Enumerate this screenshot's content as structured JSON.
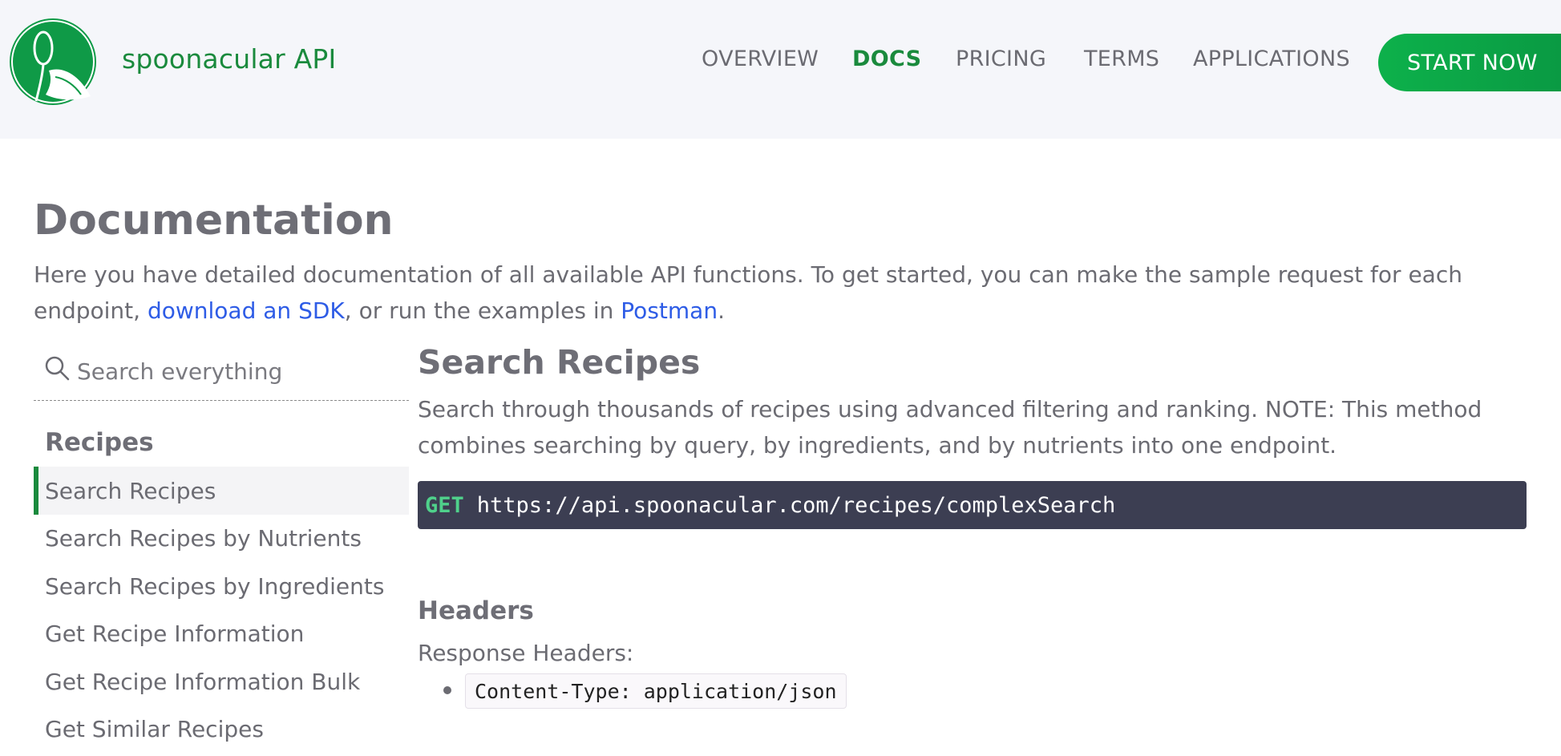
{
  "header": {
    "brand": "spoonacular API",
    "nav": [
      {
        "label": "OVERVIEW",
        "active": false
      },
      {
        "label": "DOCS",
        "active": true
      },
      {
        "label": "PRICING",
        "active": false
      },
      {
        "label": "TERMS",
        "active": false
      },
      {
        "label": "APPLICATIONS",
        "active": false
      }
    ],
    "cta_label": "START NOW",
    "logo_icon": "spoon-leaf-logo"
  },
  "intro": {
    "title": "Documentation",
    "text_before": "Here you have detailed documentation of all available API functions. To get started, you can make the sample request for each endpoint, ",
    "link_sdk": "download an SDK",
    "text_middle": ", or run the examples in ",
    "link_postman": "Postman",
    "text_after": "."
  },
  "sidebar": {
    "search_placeholder": "Search everything",
    "search_value": "",
    "section_heading": "Recipes",
    "items": [
      {
        "label": "Search Recipes",
        "active": true
      },
      {
        "label": "Search Recipes by Nutrients",
        "active": false
      },
      {
        "label": "Search Recipes by Ingredients",
        "active": false
      },
      {
        "label": "Get Recipe Information",
        "active": false
      },
      {
        "label": "Get Recipe Information Bulk",
        "active": false
      },
      {
        "label": "Get Similar Recipes",
        "active": false
      }
    ]
  },
  "main": {
    "title": "Search Recipes",
    "description": "Search through thousands of recipes using advanced filtering and ranking. NOTE: This method combines searching by query, by ingredients, and by nutrients into one endpoint.",
    "endpoint": {
      "method": "GET",
      "url": "https://api.spoonacular.com/recipes/complexSearch"
    },
    "headers_title": "Headers",
    "response_headers_label": "Response Headers:",
    "response_headers": [
      "Content-Type: application/json"
    ]
  },
  "colors": {
    "brand_green": "#1a8a3d",
    "cta_green": "#0db14b",
    "link_blue": "#2e5ce6",
    "code_bg": "#3c3e52",
    "method_green": "#4fd18b"
  }
}
